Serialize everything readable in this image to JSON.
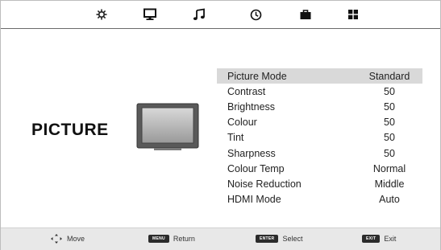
{
  "top_tabs": [
    {
      "name": "settings",
      "icon": "gear-icon"
    },
    {
      "name": "picture",
      "icon": "monitor-icon"
    },
    {
      "name": "sound",
      "icon": "music-note-icon"
    },
    {
      "name": "time",
      "icon": "clock-icon"
    },
    {
      "name": "lock",
      "icon": "briefcase-lock-icon"
    },
    {
      "name": "setup",
      "icon": "grid-icon"
    }
  ],
  "active_tab": "picture",
  "menu_title": "PICTURE",
  "settings": [
    {
      "label": "Picture Mode",
      "value": "Standard",
      "selected": true
    },
    {
      "label": "Contrast",
      "value": "50"
    },
    {
      "label": "Brightness",
      "value": "50"
    },
    {
      "label": "Colour",
      "value": "50"
    },
    {
      "label": "Tint",
      "value": "50"
    },
    {
      "label": "Sharpness",
      "value": "50"
    },
    {
      "label": "Colour Temp",
      "value": "Normal"
    },
    {
      "label": "Noise Reduction",
      "value": "Middle"
    },
    {
      "label": "HDMI Mode",
      "value": "Auto"
    }
  ],
  "hints": [
    {
      "key": "",
      "icon": "dpad-arrows-icon",
      "label": "Move"
    },
    {
      "key": "MENU",
      "label": "Return"
    },
    {
      "key": "ENTER",
      "label": "Select"
    },
    {
      "key": "EXIT",
      "label": "Exit"
    }
  ],
  "colors": {
    "selected_row": "#d9d9d9",
    "bottom_bar": "#e8e8e8",
    "key_badge": "#2b2b2b"
  }
}
